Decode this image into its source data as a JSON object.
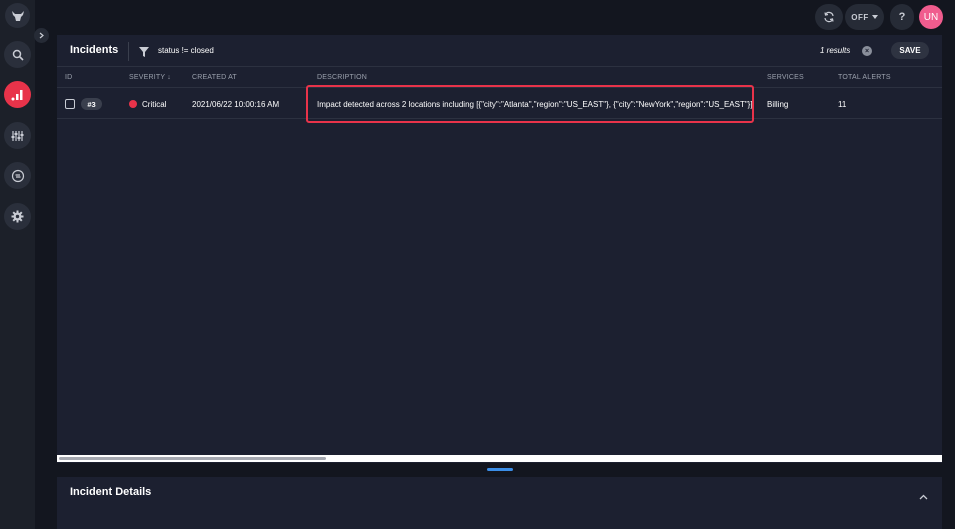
{
  "nav": {
    "items": [
      "logo",
      "search",
      "incidents",
      "controls",
      "automation",
      "settings"
    ]
  },
  "topbar": {
    "refresh_label": "",
    "toggle_label": "OFF",
    "help_label": "?",
    "avatar_initials": "UN"
  },
  "incidents": {
    "title": "Incidents",
    "filter_query": "status != closed",
    "results_text": "1 results",
    "save_label": "SAVE",
    "columns": [
      "ID",
      "SEVERITY",
      "CREATED AT",
      "DESCRIPTION",
      "SERVICES",
      "TOTAL ALERTS"
    ],
    "sort_indicator": "↓",
    "rows": [
      {
        "id": "#3",
        "severity": "Critical",
        "created_at": "2021/06/22 10:00:16 AM",
        "description": "Impact detected across 2 locations including [{\"city\":\"Atlanta\",\"region\":\"US_EAST\"}, {\"city\":\"NewYork\",\"region\":\"US_EAST\"}]",
        "services": "Billing",
        "total_alerts": "11"
      }
    ]
  },
  "details": {
    "title": "Incident Details"
  },
  "colors": {
    "accent": "#e8334a",
    "avatar": "#f05c8e",
    "handle": "#3b8ee8"
  }
}
